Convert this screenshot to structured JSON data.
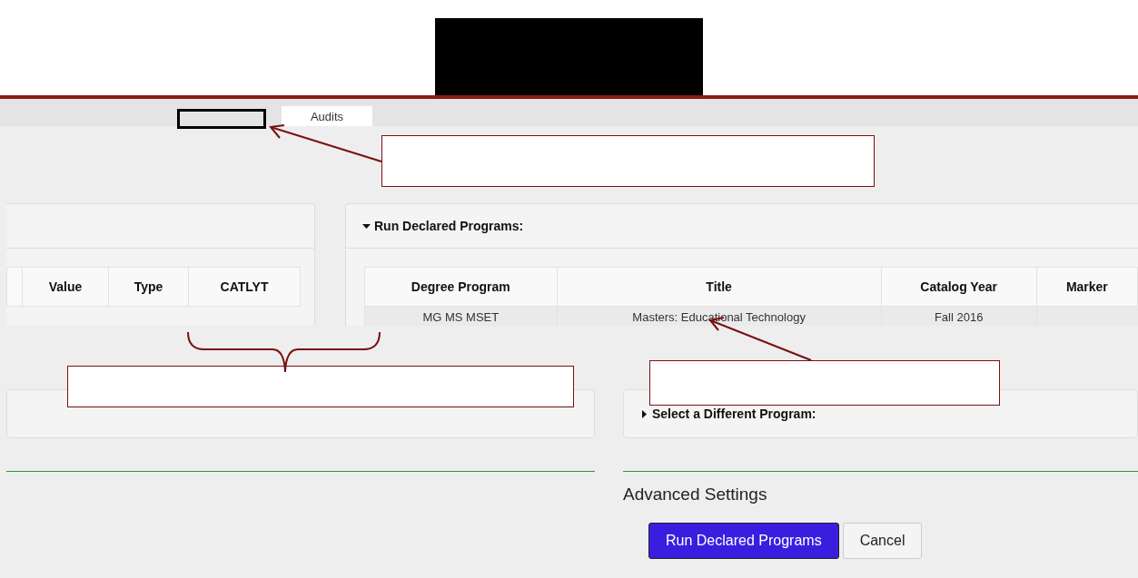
{
  "nav": {
    "tabs": [
      {
        "label": "Audits",
        "selected": true
      }
    ]
  },
  "left_panel": {
    "table": {
      "columns": [
        "Value",
        "Type",
        "CATLYT"
      ]
    }
  },
  "declared_programs": {
    "title": "Run Declared Programs:",
    "expanded": true,
    "table": {
      "columns": [
        "Degree Program",
        "Title",
        "Catalog Year",
        "Marker"
      ],
      "rows": [
        [
          "MG MS MSET",
          "Masters: Educational Technology",
          "Fall 2016"
        ]
      ]
    }
  },
  "different_program": {
    "title": "Select a Different Program:",
    "expanded": false
  },
  "advanced_settings": {
    "title": "Advanced Settings"
  },
  "buttons": [
    {
      "label": "Run Declared Programs",
      "kind": "primary"
    },
    {
      "label": "Cancel",
      "kind": "secondary"
    }
  ]
}
